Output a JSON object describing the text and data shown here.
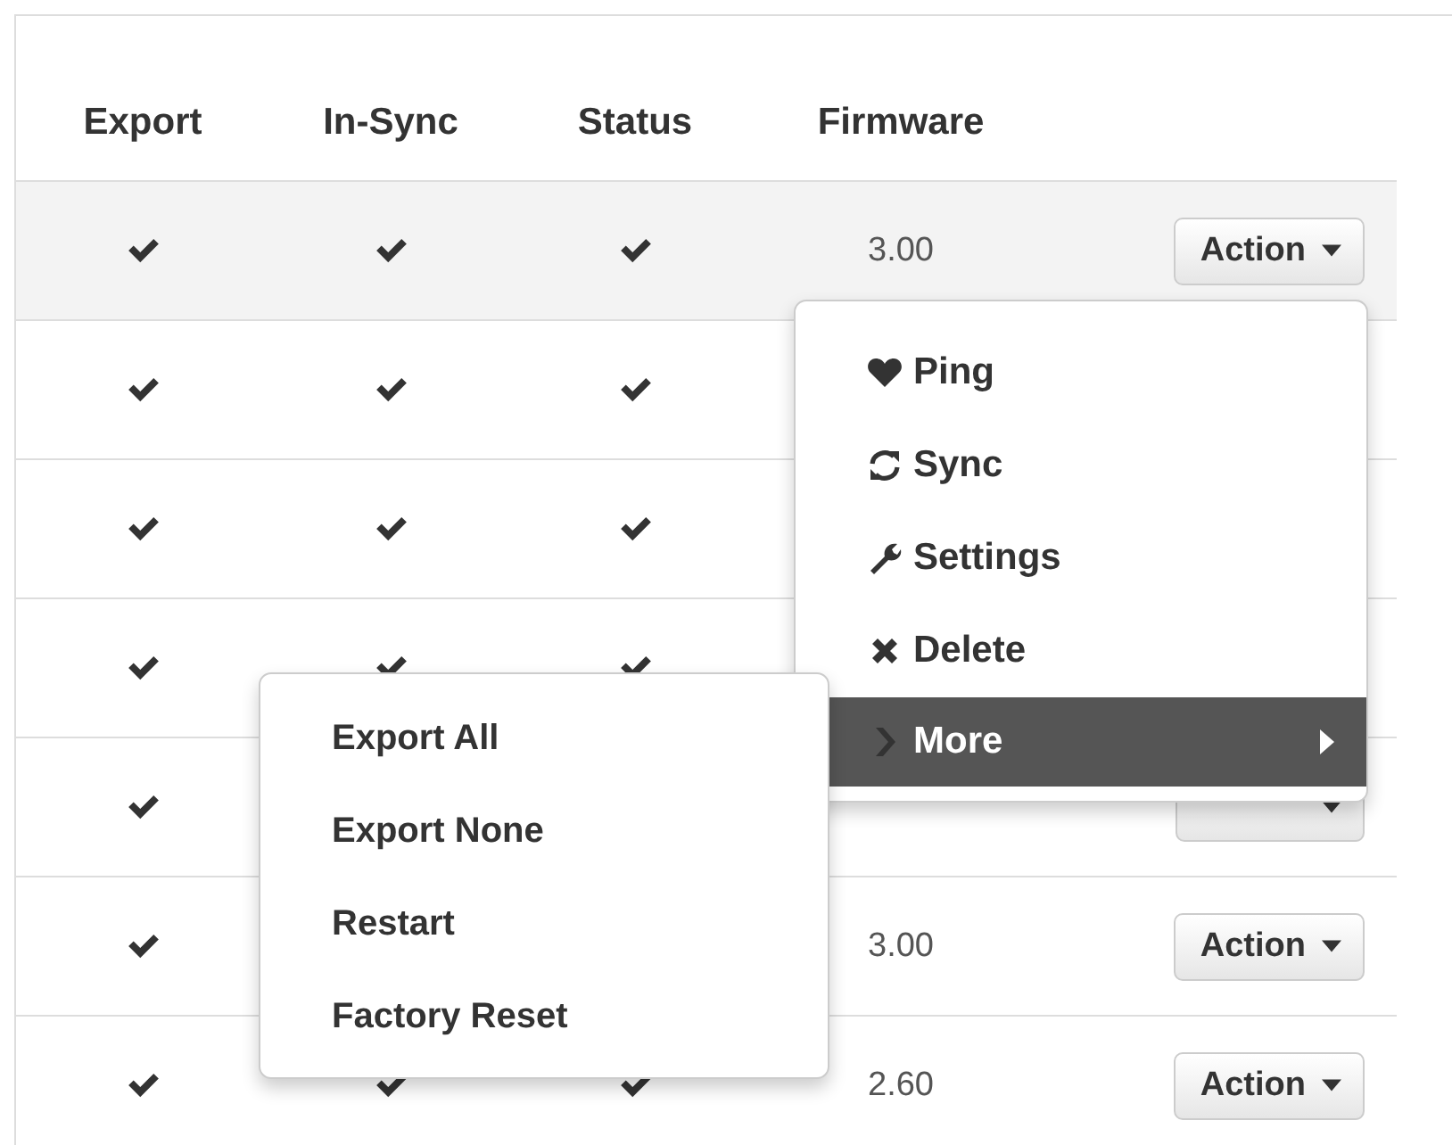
{
  "table": {
    "columns": [
      "Export",
      "In-Sync",
      "Status",
      "Firmware"
    ],
    "rows": [
      {
        "selected": true,
        "export": true,
        "in_sync": true,
        "status": true,
        "firmware": "3.00",
        "action": "Action"
      },
      {
        "selected": false,
        "export": true,
        "in_sync": true,
        "status": true
      },
      {
        "selected": false,
        "export": true,
        "in_sync": true,
        "status": true
      },
      {
        "selected": false,
        "export": true,
        "in_sync": true,
        "status": true
      },
      {
        "selected": false,
        "export": true,
        "action_button": true
      },
      {
        "selected": false,
        "export": true,
        "firmware": "3.00",
        "action": "Action"
      },
      {
        "selected": false,
        "export": true,
        "in_sync": true,
        "status": true,
        "firmware": "2.60",
        "action": "Action"
      }
    ]
  },
  "action_menu": {
    "items": [
      {
        "kind": "ping",
        "label": "Ping",
        "selected": false
      },
      {
        "kind": "sync",
        "label": "Sync",
        "selected": false
      },
      {
        "kind": "settings",
        "label": "Settings",
        "selected": false
      },
      {
        "kind": "delete",
        "label": "Delete",
        "selected": false
      },
      {
        "kind": "submenu",
        "label": "More",
        "selected": true
      }
    ]
  },
  "submenu": {
    "items": [
      {
        "label": "Export All"
      },
      {
        "label": "Export None"
      },
      {
        "label": "Restart"
      },
      {
        "label": "Factory Reset"
      }
    ]
  }
}
